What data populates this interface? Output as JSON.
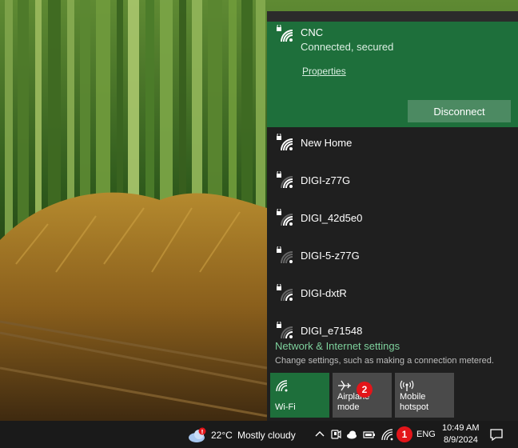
{
  "active_network": {
    "name": "CNC",
    "status": "Connected, secured",
    "properties_label": "Properties",
    "disconnect_label": "Disconnect"
  },
  "networks": [
    {
      "name": "New Home",
      "signal": "full"
    },
    {
      "name": "DIGI-z77G",
      "signal": "high"
    },
    {
      "name": "DIGI_42d5e0",
      "signal": "high"
    },
    {
      "name": "DIGI-5-z77G",
      "signal": "low"
    },
    {
      "name": "DIGI-dxtR",
      "signal": "medium"
    },
    {
      "name": "DIGI_e71548",
      "signal": "medium"
    }
  ],
  "settings": {
    "link": "Network & Internet settings",
    "description": "Change settings, such as making a connection metered."
  },
  "quick_actions": [
    {
      "label": "Wi-Fi",
      "icon": "wifi-icon",
      "active": true
    },
    {
      "label": "Airplane mode",
      "icon": "airplane-icon",
      "active": false
    },
    {
      "label": "Mobile hotspot",
      "icon": "mobile-hotspot-icon",
      "active": false
    }
  ],
  "badges": {
    "taskbar_wifi": "1",
    "airplane_tile": "2"
  },
  "taskbar": {
    "weather_temp": "22°C",
    "weather_condition": "Mostly cloudy",
    "language": "ENG",
    "time": "10:49 AM",
    "date": "8/9/2024",
    "tray_icons": [
      "chevron-up-icon",
      "meet-now-icon",
      "onedrive-icon",
      "battery-icon",
      "wifi-icon"
    ]
  },
  "colors": {
    "accent_green": "#1e6f3b",
    "link_green": "#7ed29d",
    "flyout_bg": "#1f1f1f",
    "badge_red": "#e3151a"
  }
}
